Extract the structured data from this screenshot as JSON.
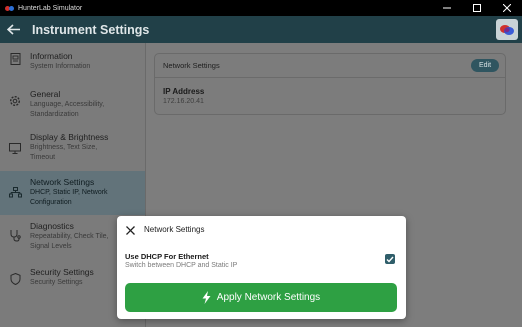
{
  "window": {
    "title": "HunterLab Simulator",
    "controls": [
      "minimize",
      "maximize",
      "close"
    ]
  },
  "header": {
    "title": "Instrument Settings",
    "back_icon": "arrow-left-icon",
    "logo_icon": "hunterlab-logo-icon"
  },
  "sidebar": {
    "items": [
      {
        "title": "Information",
        "subtitle": "System Information",
        "icon": "document-icon",
        "active": false
      },
      {
        "title": "General",
        "subtitle": "Language, Accessibility, Standardization",
        "icon": "gear-icon",
        "active": false
      },
      {
        "title": "Display & Brightness",
        "subtitle": "Brightness, Text Size, Timeout",
        "icon": "monitor-icon",
        "active": false
      },
      {
        "title": "Network Settings",
        "subtitle": "DHCP, Static IP, Network Configuration",
        "icon": "network-icon",
        "active": true
      },
      {
        "title": "Diagnostics",
        "subtitle": "Repeatability, Check Tile, Signal Levels",
        "icon": "stethoscope-icon",
        "active": false
      },
      {
        "title": "Security Settings",
        "subtitle": "Security Settings",
        "icon": "shield-icon",
        "active": false
      }
    ]
  },
  "main": {
    "card": {
      "title": "Network Settings",
      "edit_label": "Edit",
      "field_label": "IP Address",
      "field_value": "172.16.20.41"
    }
  },
  "modal": {
    "title": "Network Settings",
    "option_title": "Use DHCP For Ethernet",
    "option_subtitle": "Switch between DHCP and Static IP",
    "option_checked": true,
    "apply_label": "Apply Network Settings"
  },
  "colors": {
    "header_bg": "#214048",
    "active_nav": "#62737a",
    "apply_button": "#2ea043",
    "checkbox": "#2f5e6a"
  }
}
